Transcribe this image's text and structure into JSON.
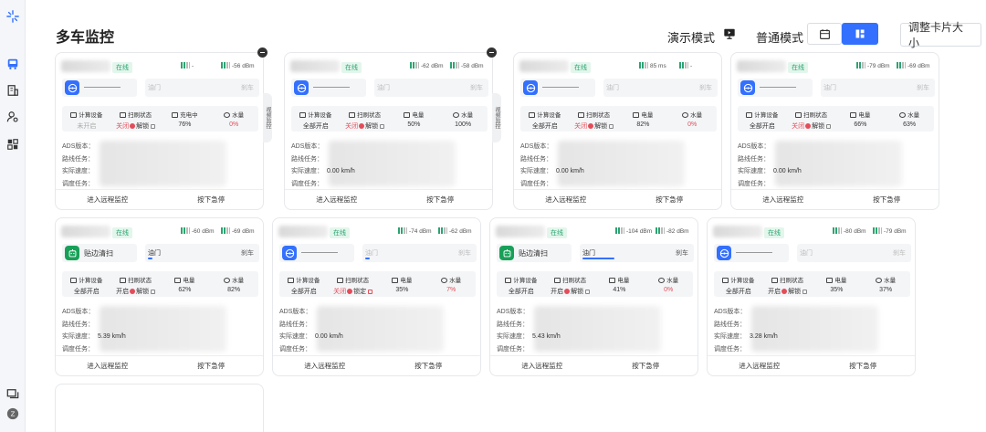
{
  "header": {
    "title": "多车监控",
    "demo_mode_label": "演示模式",
    "normal_mode_label": "普通模式",
    "resize_button": "调整卡片大小"
  },
  "labels": {
    "online": "在线",
    "compute": "计算设备",
    "sweep": "扫刷状态",
    "battery": "电量",
    "charging": "充电中",
    "water": "水量",
    "ads_version": "ADS版本：",
    "route_task": "路线任务：",
    "actual_speed": "实际速度：",
    "dispatch_task": "调度任务：",
    "remote": "进入远程监控",
    "estop": "按下急停",
    "throttle": "油门",
    "brake": "刹车",
    "side_tab": "视频监控"
  },
  "cards": [
    {
      "signal_left": "-",
      "signal_right": "-56 dBm",
      "mode": "",
      "compute": "未开启",
      "sweep_a": "关闭",
      "sweep_b": "解锁",
      "power_label": "充电中",
      "power": "76%",
      "water": "0%",
      "speed": ""
    },
    {
      "signal_left": "-62 dBm",
      "signal_right": "-58 dBm",
      "mode": "",
      "compute": "全部开启",
      "sweep_a": "关闭",
      "sweep_b": "解锁",
      "power_label": "电量",
      "power": "50%",
      "water": "100%",
      "speed": "0.00 km/h"
    },
    {
      "signal_left": "85 ms",
      "signal_right": "-",
      "mode": "",
      "compute": "全部开启",
      "sweep_a": "关闭",
      "sweep_b": "解锁",
      "power_label": "电量",
      "power": "82%",
      "water": "0%",
      "speed": "0.00 km/h"
    },
    {
      "signal_left": "-79 dBm",
      "signal_right": "-69 dBm",
      "mode": "",
      "compute": "全部开启",
      "sweep_a": "关闭",
      "sweep_b": "解锁",
      "power_label": "电量",
      "power": "66%",
      "water": "63%",
      "speed": "0.00 km/h"
    },
    {
      "signal_left": "-60 dBm",
      "signal_right": "-69 dBm",
      "mode": "贴边清扫",
      "compute": "全部开启",
      "sweep_a": "开启",
      "sweep_b": "解锁",
      "power_label": "电量",
      "power": "62%",
      "water": "82%",
      "speed": "5.39 km/h"
    },
    {
      "signal_left": "-74 dBm",
      "signal_right": "-62 dBm",
      "mode": "",
      "compute": "全部开启",
      "sweep_a": "关闭",
      "sweep_b": "锁定",
      "power_label": "电量",
      "power": "35%",
      "water": "7%",
      "speed": "0.00 km/h"
    },
    {
      "signal_left": "-104 dBm",
      "signal_right": "-82 dBm",
      "mode": "贴边清扫",
      "compute": "全部开启",
      "sweep_a": "开启",
      "sweep_b": "解锁",
      "power_label": "电量",
      "power": "41%",
      "water": "0%",
      "speed": "5.43 km/h"
    },
    {
      "signal_left": "-80 dBm",
      "signal_right": "-79 dBm",
      "mode": "",
      "compute": "全部开启",
      "sweep_a": "开启",
      "sweep_b": "解锁",
      "power_label": "电量",
      "power": "35%",
      "water": "37%",
      "speed": "3.28 km/h"
    }
  ],
  "colors": {
    "accent": "#3370ff",
    "online": "#2ba471",
    "danger": "#e34d59",
    "green_mode": "#18a058"
  },
  "icons": [
    "bus-icon",
    "building-icon",
    "user-settings-icon",
    "grid-icon",
    "chat-icon",
    "avatar-icon",
    "steering-wheel-icon",
    "monitor-icon",
    "robot-icon"
  ]
}
